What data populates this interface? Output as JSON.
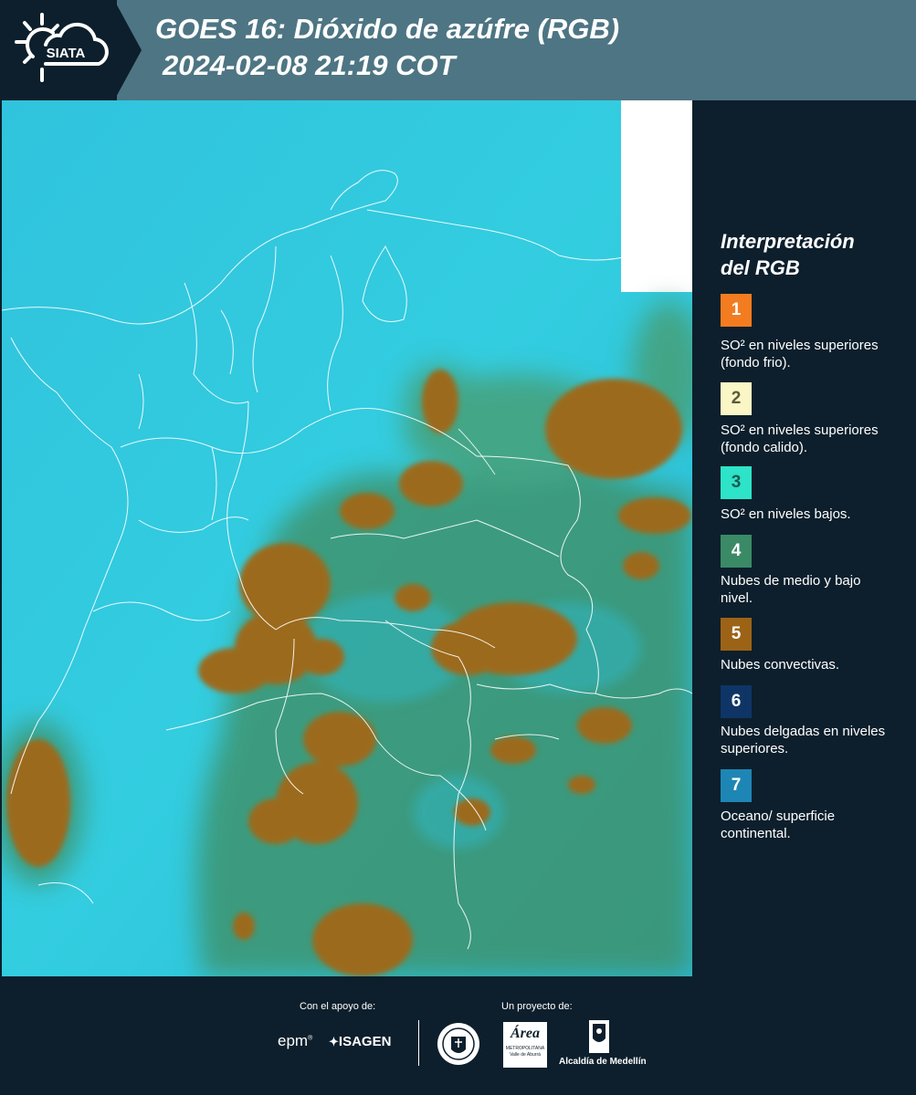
{
  "header": {
    "logo_text": "SIATA",
    "title_line1": "GOES 16: Dióxido de azúfre (RGB)",
    "title_line2": "2024-02-08 21:19 COT"
  },
  "legend": {
    "title_line1": "Interpretación",
    "title_line2": "del RGB",
    "items": [
      {
        "num": "1",
        "color": "#f47c20",
        "text": "SO² en niveles superiores (fondo frio)."
      },
      {
        "num": "2",
        "color": "#fbf6c6",
        "text": "SO² en niveles superiores (fondo calido)."
      },
      {
        "num": "3",
        "color": "#2de3c8",
        "text": "SO² en niveles bajos."
      },
      {
        "num": "4",
        "color": "#3a8a66",
        "text": "Nubes de medio y bajo nivel."
      },
      {
        "num": "5",
        "color": "#9c6316",
        "text": "Nubes convectivas."
      },
      {
        "num": "6",
        "color": "#0e3566",
        "text": "Nubes delgadas en niveles superiores."
      },
      {
        "num": "7",
        "color": "#1e86b5",
        "text": "Oceano/ superficie continental."
      }
    ]
  },
  "footer": {
    "support_label": "Con el apoyo de:",
    "project_label": "Un proyecto de:",
    "sponsor1": "epm",
    "sponsor2": "ISAGEN",
    "partner_area_line1": "Área",
    "partner_area_line2": "METROPOLITANA",
    "partner_area_line3": "Valle de Aburrá",
    "partner_medellin": "Alcaldía de Medellín"
  },
  "colors": {
    "background": "#0d1f2c",
    "header": "#4e7583",
    "ocean_cyan": "#2ec9df",
    "convective": "#9c6316",
    "mid_low_cloud": "#3a8a66"
  }
}
